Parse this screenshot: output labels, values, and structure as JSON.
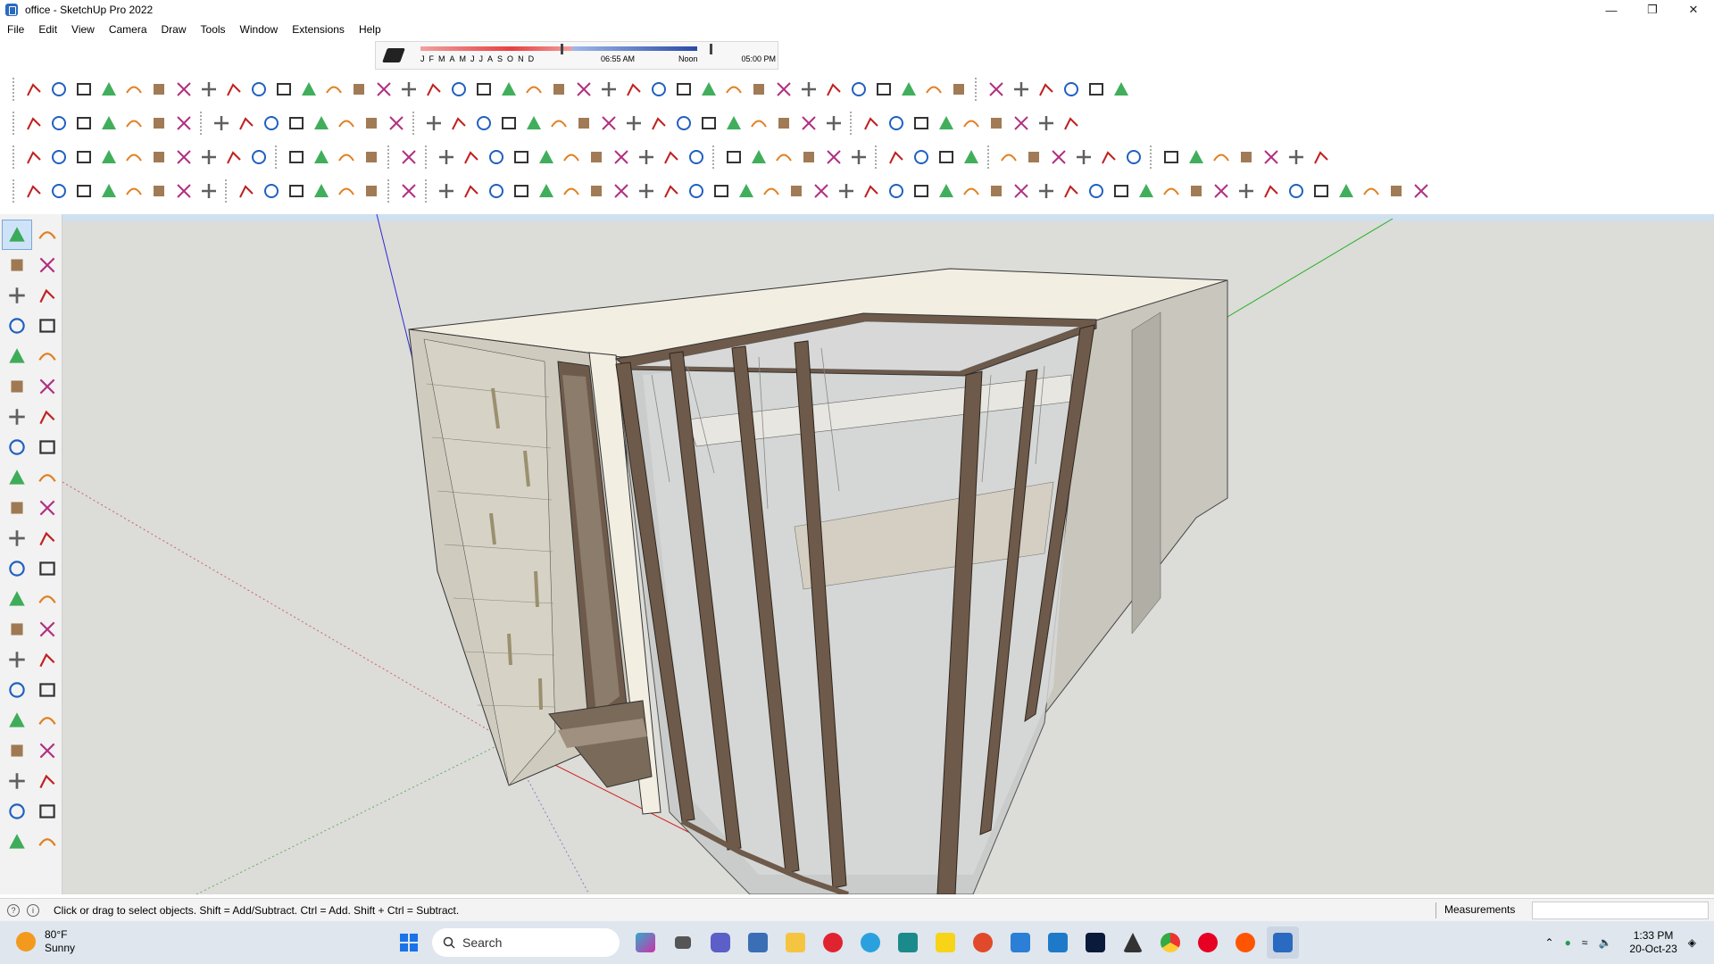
{
  "window": {
    "title": "office - SketchUp Pro 2022",
    "controls": [
      "minimize-icon",
      "restore-icon",
      "close-icon"
    ]
  },
  "menu": [
    "File",
    "Edit",
    "View",
    "Camera",
    "Draw",
    "Tools",
    "Window",
    "Extensions",
    "Help"
  ],
  "shadow_settings": {
    "months": [
      "J",
      "F",
      "M",
      "A",
      "M",
      "J",
      "J",
      "A",
      "S",
      "O",
      "N",
      "D"
    ],
    "time_start": "06:55 AM",
    "time_mid": "Noon",
    "time_end": "05:00 PM"
  },
  "status": {
    "hint": "Click or drag to select objects. Shift = Add/Subtract. Ctrl = Add. Shift + Ctrl = Subtract.",
    "measurements_label": "Measurements",
    "measurements_value": ""
  },
  "taskbar": {
    "weather_temp": "80°F",
    "weather_desc": "Sunny",
    "search_placeholder": "Search",
    "time": "1:33 PM",
    "date": "20-Oct-23"
  },
  "colors": {
    "accent": "#2a6ac0",
    "viewport_bg": "#dcdcd8",
    "glass_frame": "#6e5a4a",
    "stone": "#cfcbbf",
    "axis_red": "#d02020",
    "axis_green": "#20b020",
    "axis_blue": "#2020d0"
  }
}
